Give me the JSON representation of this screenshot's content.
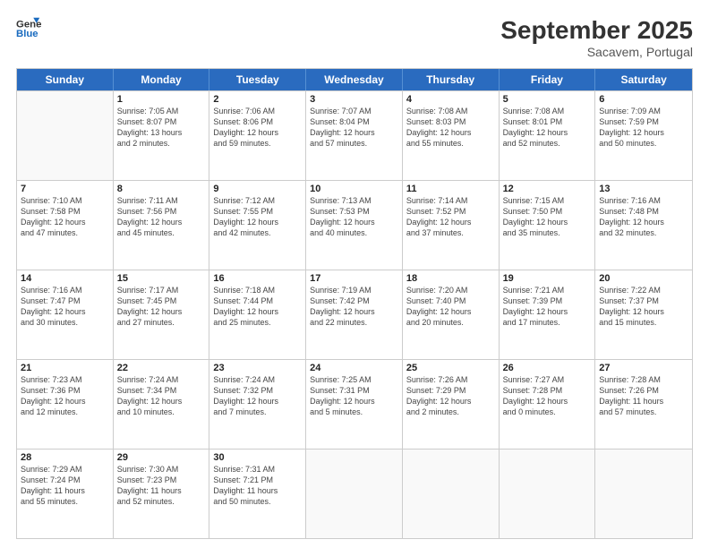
{
  "header": {
    "logo_general": "General",
    "logo_blue": "Blue",
    "month_title": "September 2025",
    "subtitle": "Sacavem, Portugal"
  },
  "days_of_week": [
    "Sunday",
    "Monday",
    "Tuesday",
    "Wednesday",
    "Thursday",
    "Friday",
    "Saturday"
  ],
  "weeks": [
    [
      {
        "day": "",
        "info": ""
      },
      {
        "day": "1",
        "info": "Sunrise: 7:05 AM\nSunset: 8:07 PM\nDaylight: 13 hours\nand 2 minutes."
      },
      {
        "day": "2",
        "info": "Sunrise: 7:06 AM\nSunset: 8:06 PM\nDaylight: 12 hours\nand 59 minutes."
      },
      {
        "day": "3",
        "info": "Sunrise: 7:07 AM\nSunset: 8:04 PM\nDaylight: 12 hours\nand 57 minutes."
      },
      {
        "day": "4",
        "info": "Sunrise: 7:08 AM\nSunset: 8:03 PM\nDaylight: 12 hours\nand 55 minutes."
      },
      {
        "day": "5",
        "info": "Sunrise: 7:08 AM\nSunset: 8:01 PM\nDaylight: 12 hours\nand 52 minutes."
      },
      {
        "day": "6",
        "info": "Sunrise: 7:09 AM\nSunset: 7:59 PM\nDaylight: 12 hours\nand 50 minutes."
      }
    ],
    [
      {
        "day": "7",
        "info": "Sunrise: 7:10 AM\nSunset: 7:58 PM\nDaylight: 12 hours\nand 47 minutes."
      },
      {
        "day": "8",
        "info": "Sunrise: 7:11 AM\nSunset: 7:56 PM\nDaylight: 12 hours\nand 45 minutes."
      },
      {
        "day": "9",
        "info": "Sunrise: 7:12 AM\nSunset: 7:55 PM\nDaylight: 12 hours\nand 42 minutes."
      },
      {
        "day": "10",
        "info": "Sunrise: 7:13 AM\nSunset: 7:53 PM\nDaylight: 12 hours\nand 40 minutes."
      },
      {
        "day": "11",
        "info": "Sunrise: 7:14 AM\nSunset: 7:52 PM\nDaylight: 12 hours\nand 37 minutes."
      },
      {
        "day": "12",
        "info": "Sunrise: 7:15 AM\nSunset: 7:50 PM\nDaylight: 12 hours\nand 35 minutes."
      },
      {
        "day": "13",
        "info": "Sunrise: 7:16 AM\nSunset: 7:48 PM\nDaylight: 12 hours\nand 32 minutes."
      }
    ],
    [
      {
        "day": "14",
        "info": "Sunrise: 7:16 AM\nSunset: 7:47 PM\nDaylight: 12 hours\nand 30 minutes."
      },
      {
        "day": "15",
        "info": "Sunrise: 7:17 AM\nSunset: 7:45 PM\nDaylight: 12 hours\nand 27 minutes."
      },
      {
        "day": "16",
        "info": "Sunrise: 7:18 AM\nSunset: 7:44 PM\nDaylight: 12 hours\nand 25 minutes."
      },
      {
        "day": "17",
        "info": "Sunrise: 7:19 AM\nSunset: 7:42 PM\nDaylight: 12 hours\nand 22 minutes."
      },
      {
        "day": "18",
        "info": "Sunrise: 7:20 AM\nSunset: 7:40 PM\nDaylight: 12 hours\nand 20 minutes."
      },
      {
        "day": "19",
        "info": "Sunrise: 7:21 AM\nSunset: 7:39 PM\nDaylight: 12 hours\nand 17 minutes."
      },
      {
        "day": "20",
        "info": "Sunrise: 7:22 AM\nSunset: 7:37 PM\nDaylight: 12 hours\nand 15 minutes."
      }
    ],
    [
      {
        "day": "21",
        "info": "Sunrise: 7:23 AM\nSunset: 7:36 PM\nDaylight: 12 hours\nand 12 minutes."
      },
      {
        "day": "22",
        "info": "Sunrise: 7:24 AM\nSunset: 7:34 PM\nDaylight: 12 hours\nand 10 minutes."
      },
      {
        "day": "23",
        "info": "Sunrise: 7:24 AM\nSunset: 7:32 PM\nDaylight: 12 hours\nand 7 minutes."
      },
      {
        "day": "24",
        "info": "Sunrise: 7:25 AM\nSunset: 7:31 PM\nDaylight: 12 hours\nand 5 minutes."
      },
      {
        "day": "25",
        "info": "Sunrise: 7:26 AM\nSunset: 7:29 PM\nDaylight: 12 hours\nand 2 minutes."
      },
      {
        "day": "26",
        "info": "Sunrise: 7:27 AM\nSunset: 7:28 PM\nDaylight: 12 hours\nand 0 minutes."
      },
      {
        "day": "27",
        "info": "Sunrise: 7:28 AM\nSunset: 7:26 PM\nDaylight: 11 hours\nand 57 minutes."
      }
    ],
    [
      {
        "day": "28",
        "info": "Sunrise: 7:29 AM\nSunset: 7:24 PM\nDaylight: 11 hours\nand 55 minutes."
      },
      {
        "day": "29",
        "info": "Sunrise: 7:30 AM\nSunset: 7:23 PM\nDaylight: 11 hours\nand 52 minutes."
      },
      {
        "day": "30",
        "info": "Sunrise: 7:31 AM\nSunset: 7:21 PM\nDaylight: 11 hours\nand 50 minutes."
      },
      {
        "day": "",
        "info": ""
      },
      {
        "day": "",
        "info": ""
      },
      {
        "day": "",
        "info": ""
      },
      {
        "day": "",
        "info": ""
      }
    ]
  ]
}
